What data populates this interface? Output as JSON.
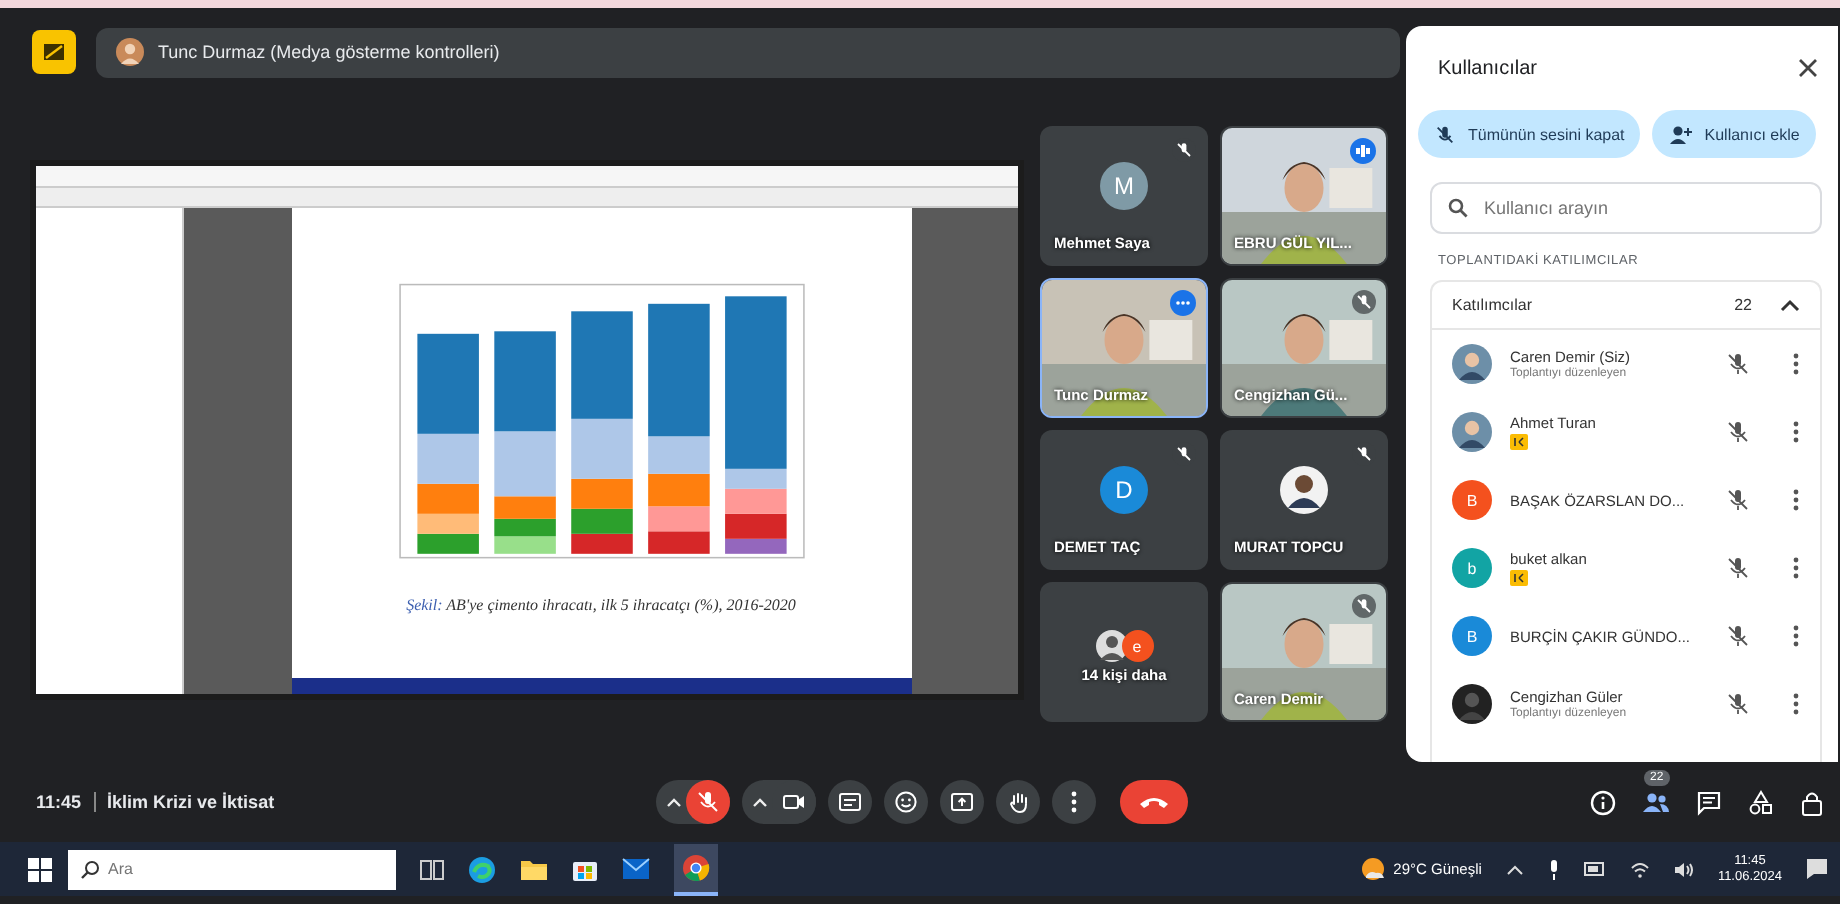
{
  "presenter_banner": {
    "text": "Tunc Durmaz (Medya gösterme kontrolleri)"
  },
  "shared_document": {
    "caption_label": "Şekil:",
    "caption_text": "AB'ye çimento ihracatı, ilk 5 ihracatçı (%), 2016-2020"
  },
  "tiles": [
    {
      "kind": "avatar",
      "name": "Mehmet Saya",
      "letter": "M",
      "color": "#7f9aa6",
      "muted": true,
      "speaking": false,
      "highlighted": false
    },
    {
      "kind": "video",
      "name": "EBRU GÜL YIL...",
      "muted": false,
      "speaking": true,
      "highlighted": false
    },
    {
      "kind": "video",
      "name": "Tunc Durmaz",
      "muted": false,
      "speaking": false,
      "highlighted": true
    },
    {
      "kind": "video",
      "name": "Cengizhan Gü...",
      "muted": true,
      "speaking": false,
      "highlighted": false
    },
    {
      "kind": "avatar",
      "name": "DEMET TAÇ",
      "letter": "D",
      "color": "#1a8ad8",
      "muted": true,
      "speaking": false,
      "highlighted": false
    },
    {
      "name": "MURAT TOPCU",
      "muted": true,
      "speaking": false,
      "highlighted": false
    },
    {
      "kind": "more",
      "name": "14 kişi daha",
      "letter": "e",
      "color": "#f4511e",
      "muted": false,
      "speaking": false,
      "highlighted": false
    },
    {
      "kind": "video",
      "name": "Caren Demir",
      "muted": true,
      "speaking": false,
      "highlighted": false
    }
  ],
  "panel": {
    "title": "Kullanıcılar",
    "mute_all": "Tümünün sesini kapat",
    "add_user": "Kullanıcı ekle",
    "search": {
      "placeholder": "Kullanıcı arayın"
    },
    "section": "TOPLANTIDAKİ KATILIMCILAR",
    "group": {
      "label": "Katılımcılar",
      "count": "22",
      "expanded": true
    },
    "participants": [
      {
        "name": "Caren Demir (Siz)",
        "role": "Toplantıyı düzenleyen",
        "tagged": false
      },
      {
        "name": "Ahmet Turan",
        "tagged": true
      },
      {
        "kind": "letter",
        "letter": "B",
        "color": "#f4511e",
        "name": "BAŞAK ÖZARSLAN DO...",
        "tagged": false
      },
      {
        "kind": "letter",
        "letter": "b",
        "color": "#12a4a4",
        "name": "buket alkan",
        "tagged": true
      },
      {
        "kind": "letter",
        "letter": "B",
        "color": "#1a8ad8",
        "name": "BURÇİN ÇAKIR GÜNDO...",
        "tagged": false
      },
      {
        "name": "Cengizhan Güler",
        "role": "Toplantıyı düzenleyen",
        "tagged": false
      }
    ]
  },
  "meeting_bar": {
    "time": "11:45",
    "title": "İklim Krizi ve İktisat",
    "mic_muted": true,
    "people_count": "22",
    "people_selected": true
  },
  "taskbar": {
    "search_placeholder": "Ara",
    "weather": "29°C Güneşli",
    "time": "11:45",
    "date": "11.06.2024"
  }
}
